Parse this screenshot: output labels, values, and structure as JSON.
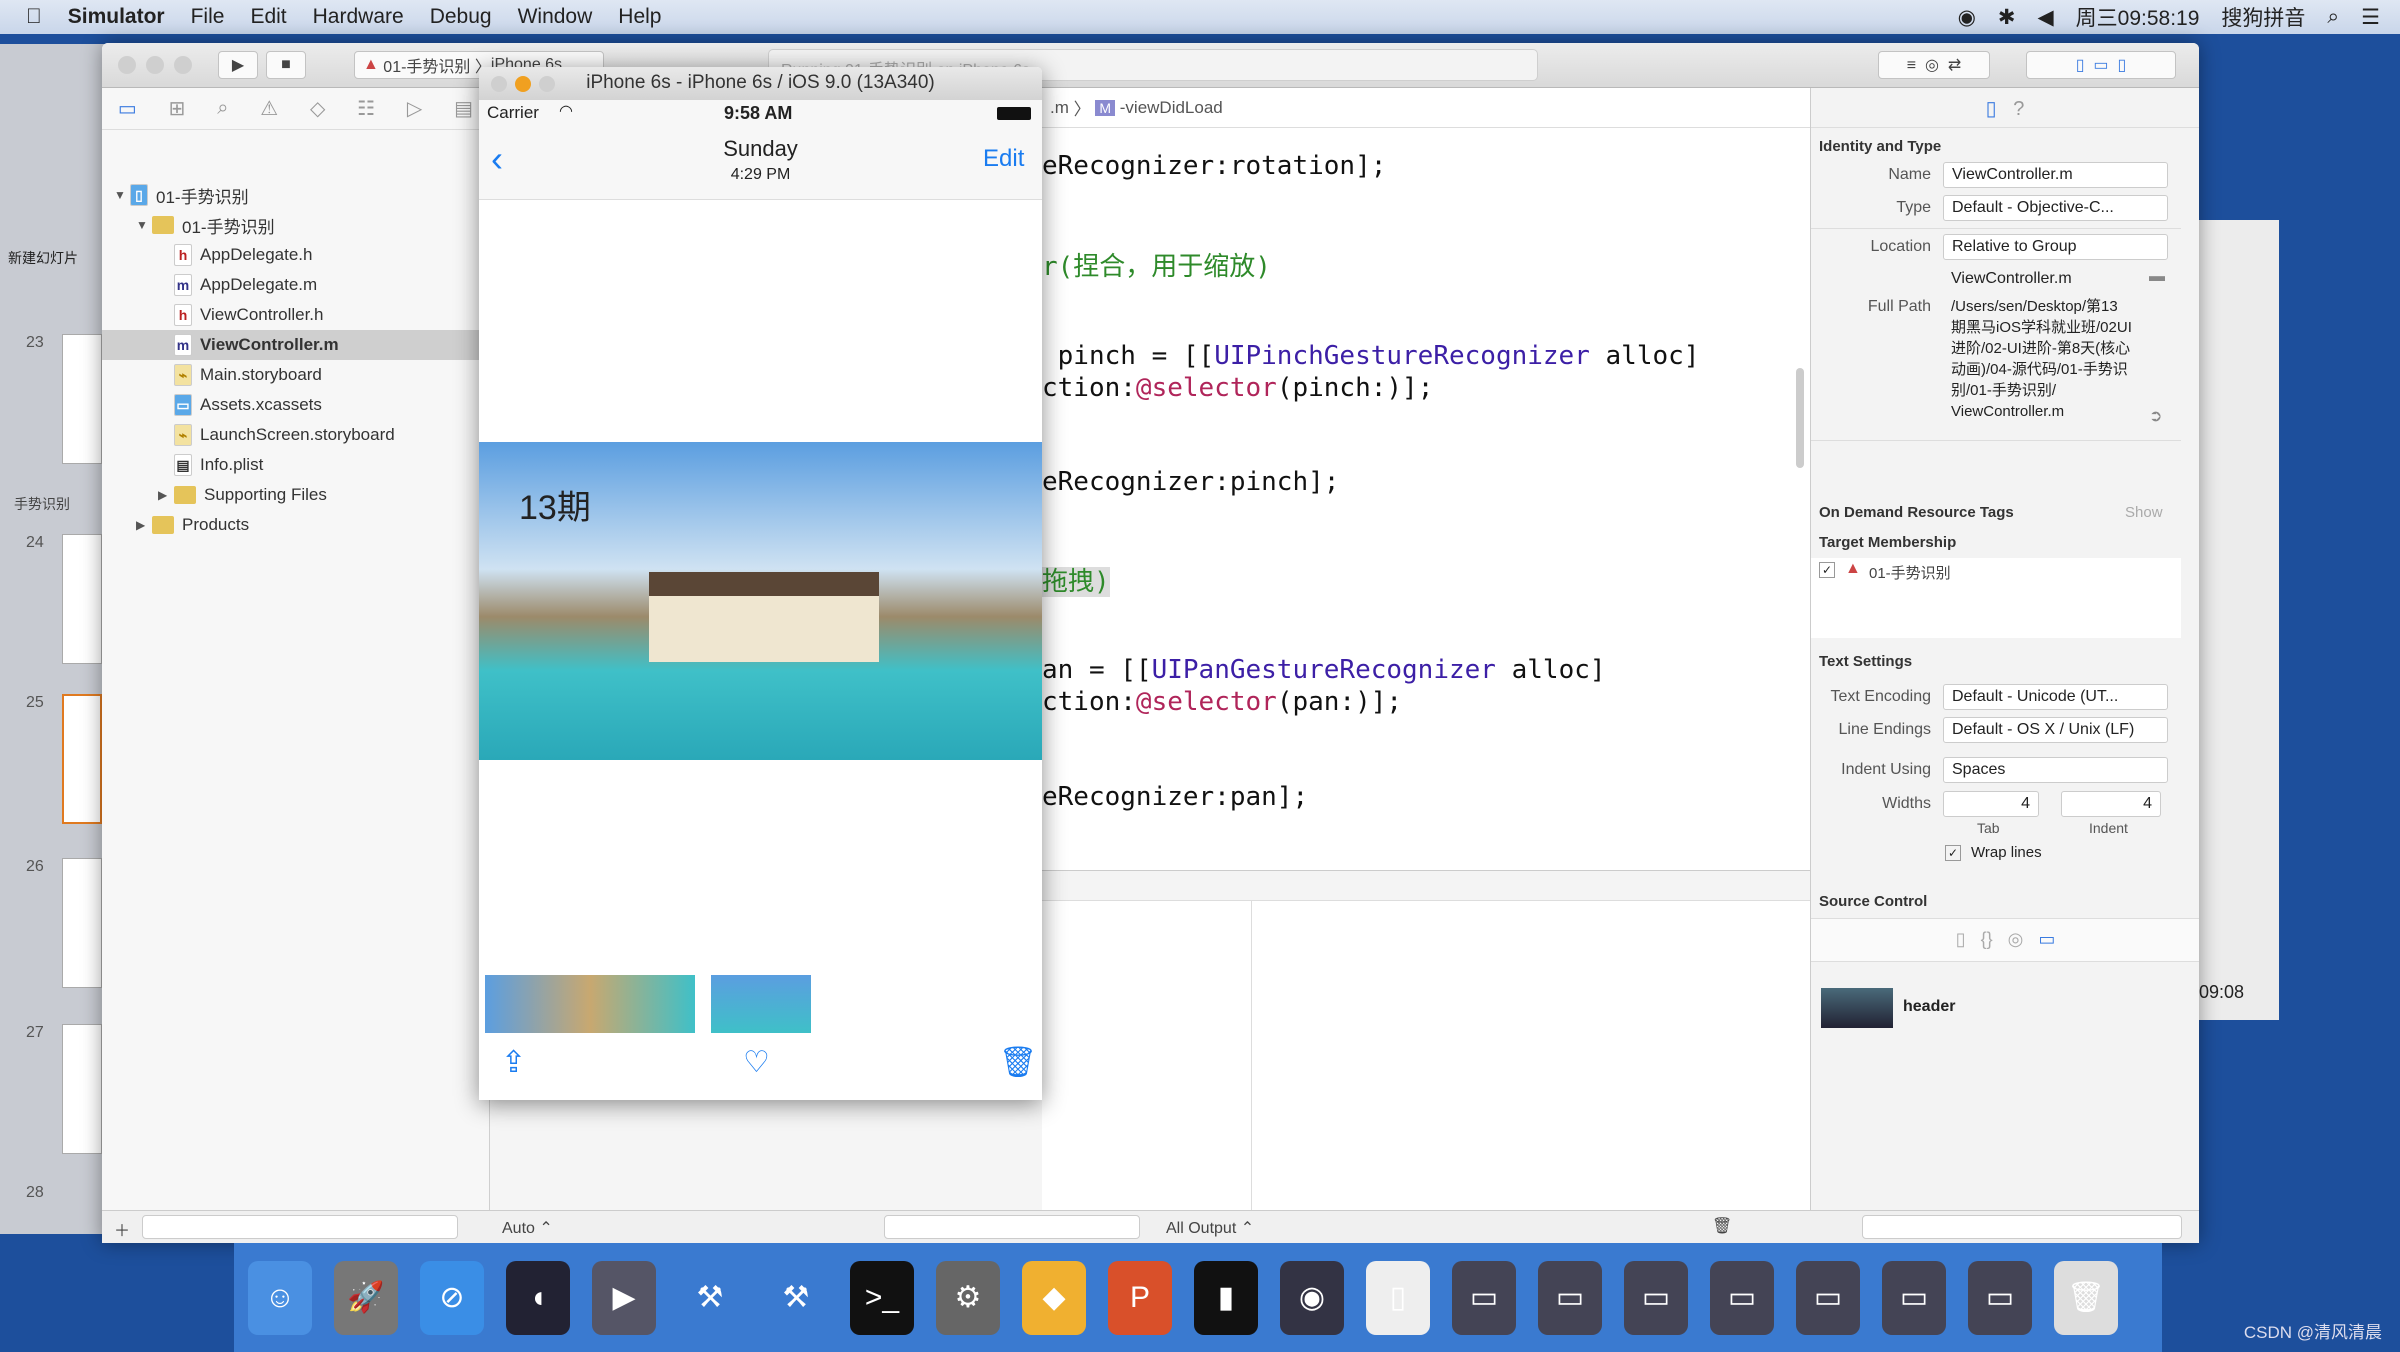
{
  "menubar": {
    "app": "Simulator",
    "items": [
      "File",
      "Edit",
      "Hardware",
      "Debug",
      "Window",
      "Help"
    ],
    "clock": "周三09:58:19",
    "input_method": "搜狗拼音"
  },
  "behind_app": {
    "new_slide": "新建幻灯片",
    "section": "手势识别",
    "slide_numbers": [
      "23",
      "24",
      "25",
      "26",
      "27",
      "28"
    ]
  },
  "toolbar": {
    "scheme": "01-手势识别",
    "device": "iPhone 6s",
    "activity": "Running 01-手势识别 on iPhone 6s"
  },
  "navigator": {
    "items": [
      {
        "label": "01-手势识别",
        "type": "project",
        "depth": 0,
        "expanded": true
      },
      {
        "label": "01-手势识别",
        "type": "folder",
        "depth": 1,
        "expanded": true
      },
      {
        "label": "AppDelegate.h",
        "type": "h",
        "depth": 2
      },
      {
        "label": "AppDelegate.m",
        "type": "m",
        "depth": 2
      },
      {
        "label": "ViewController.h",
        "type": "h",
        "depth": 2
      },
      {
        "label": "ViewController.m",
        "type": "m",
        "depth": 2,
        "selected": true
      },
      {
        "label": "Main.storyboard",
        "type": "storyboard",
        "depth": 2
      },
      {
        "label": "Assets.xcassets",
        "type": "assets",
        "depth": 2
      },
      {
        "label": "LaunchScreen.storyboard",
        "type": "storyboard",
        "depth": 2
      },
      {
        "label": "Info.plist",
        "type": "plist",
        "depth": 2
      },
      {
        "label": "Supporting Files",
        "type": "folder",
        "depth": 2,
        "expanded": false
      },
      {
        "label": "Products",
        "type": "folder",
        "depth": 1,
        "expanded": false
      }
    ]
  },
  "editor": {
    "jumpbar_file": ".m",
    "jumpbar_method": "-viewDidLoad",
    "lines": [
      [
        {
          "t": "eRecognizer:rotation];"
        }
      ],
      [
        {
          "t": "r(捏合，用于缩放)",
          "c": "cm"
        }
      ],
      [
        {
          "t": " pinch = [["
        },
        {
          "t": "UIPinchGestureRecognizer",
          "c": "cls"
        },
        {
          "t": " alloc]"
        }
      ],
      [
        {
          "t": "ction:"
        },
        {
          "t": "@selector",
          "c": "kw"
        },
        {
          "t": "(pinch:)];"
        }
      ],
      [
        {
          "t": "eRecognizer:pinch];"
        }
      ],
      [
        {
          "t": "拖拽)",
          "c": "cm"
        }
      ],
      [
        {
          "t": "an = [["
        },
        {
          "t": "UIPanGestureRecognizer",
          "c": "cls"
        },
        {
          "t": " alloc]"
        }
      ],
      [
        {
          "t": "ction:"
        },
        {
          "t": "@selector",
          "c": "kw"
        },
        {
          "t": "(pan:)];"
        }
      ],
      [
        {
          "t": "eRecognizer:pan];"
        }
      ]
    ]
  },
  "debug": {
    "auto": "Auto ⌃",
    "output": "All Output ⌃"
  },
  "simulator": {
    "title": "iPhone 6s - iPhone 6s / iOS 9.0 (13A340)",
    "carrier": "Carrier",
    "time": "9:58 AM",
    "nav_title": "Sunday",
    "nav_subtitle": "4:29 PM",
    "edit": "Edit",
    "photo_caption": "13期"
  },
  "inspector": {
    "identity_header": "Identity and Type",
    "name_label": "Name",
    "name": "ViewController.m",
    "type_label": "Type",
    "type": "Default - Objective-C...",
    "location_label": "Location",
    "location": "Relative to Group",
    "location_file": "ViewController.m",
    "fullpath_label": "Full Path",
    "fullpath_lines": [
      "/Users/sen/Desktop/第13",
      "期黑马iOS学科就业班/02UI",
      "进阶/02-UI进阶-第8天(核心",
      "动画)/04-源代码/01-手势识",
      "别/01-手势识别/",
      "ViewController.m"
    ],
    "odr_header": "On Demand Resource Tags",
    "odr_show": "Show",
    "target_header": "Target Membership",
    "target": "01-手势识别",
    "text_header": "Text Settings",
    "encoding_label": "Text Encoding",
    "encoding": "Default - Unicode (UT...",
    "endings_label": "Line Endings",
    "endings": "Default - OS X / Unix (LF)",
    "indent_label": "Indent Using",
    "indent": "Spaces",
    "widths_label": "Widths",
    "tab_width": "4",
    "indent_width": "4",
    "tab_label": "Tab",
    "indent_w_label": "Indent",
    "wrap": "Wrap lines",
    "source_header": "Source Control",
    "library_item": "header"
  },
  "behind_right": {
    "time": "09:08"
  },
  "dock": {
    "apps": [
      "Finder",
      "Launchpad",
      "Safari",
      "Mouse",
      "Photo Slideshow",
      "Xcode",
      "Xcode Beta",
      "Terminal",
      "System Preferences",
      "Sketch",
      "PowerPoint",
      "Console",
      "QuickTime",
      "Preview",
      "Window 1",
      "Window 2",
      "Window 3",
      "Window 4",
      "Window 5",
      "Window 6",
      "Window 7",
      "Trash"
    ]
  },
  "watermark": "CSDN @清风清晨"
}
